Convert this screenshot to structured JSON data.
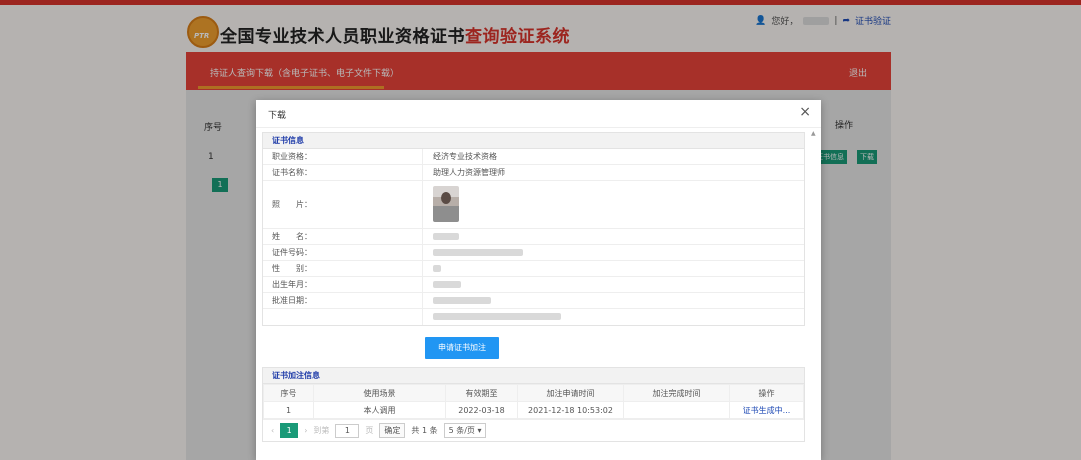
{
  "header": {
    "logo_text": "PTR",
    "title_black": "全国专业技术人员职业资格证书",
    "title_red": "查询验证系统",
    "greeting": "您好，",
    "separator": "|",
    "verify_link": "证书验证"
  },
  "nav": {
    "main_tab": "持证人查询下载（含电子证书、电子文件下载）",
    "logout": "退出"
  },
  "background_table": {
    "col_index": "序号",
    "col_action": "操作",
    "row_index": "1",
    "btn_info": "证书信息",
    "btn_download": "下载",
    "page": "1"
  },
  "modal": {
    "title": "下载",
    "close": "×",
    "cert_section_title": "证书信息",
    "rows": [
      {
        "label": "职业资格：",
        "value": "经济专业技术资格"
      },
      {
        "label": "证书名称：",
        "value": "助理人力资源管理师"
      }
    ],
    "photo_label": "照　　片：",
    "name_label": "姓　　名：",
    "id_label": "证件号码：",
    "gender_label": "性　　别：",
    "birth_label": "出生年月：",
    "approve_label": "批准日期：",
    "apply_button": "申请证书加注",
    "annot_section_title": "证书加注信息",
    "annot_columns": [
      "序号",
      "使用场景",
      "有效期至",
      "加注申请时间",
      "加注完成时间",
      "操作"
    ],
    "annot_rows": [
      {
        "index": "1",
        "scene": "本人调用",
        "valid_until": "2022-03-18",
        "apply_time": "2021-12-18 10:53:02",
        "done_time": "",
        "action": "证书生成中..."
      }
    ],
    "pager": {
      "prev": "‹",
      "current": "1",
      "next": "›",
      "goto_label": "到第",
      "goto_value": "1",
      "page_unit": "页",
      "confirm": "确定",
      "total": "共 1 条",
      "page_size": "5 条/页"
    }
  }
}
